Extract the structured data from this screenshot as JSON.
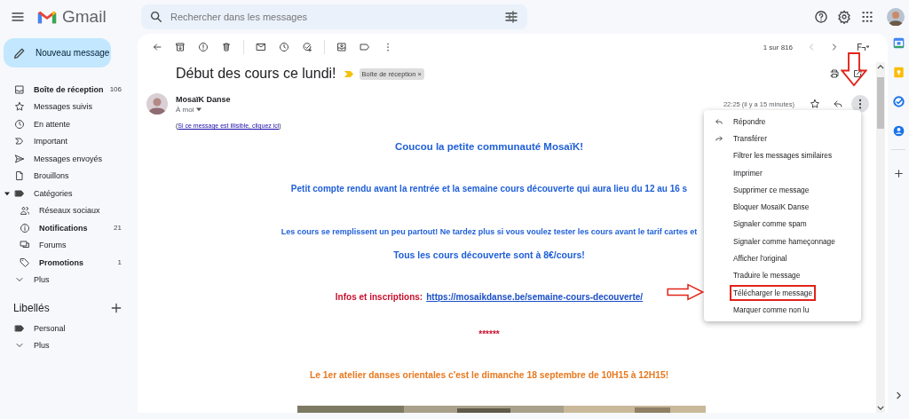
{
  "header": {
    "app_name": "Gmail",
    "search": {
      "placeholder": "Rechercher dans les messages"
    }
  },
  "compose": "Nouveau message",
  "sidebar": {
    "items": [
      {
        "label": "Boîte de réception",
        "count": "106",
        "unread": true
      },
      {
        "label": "Messages suivis",
        "unread": false
      },
      {
        "label": "En attente",
        "unread": false
      },
      {
        "label": "Important",
        "unread": false
      },
      {
        "label": "Messages envoyés",
        "unread": false
      },
      {
        "label": "Brouillons",
        "unread": false
      },
      {
        "label": "Catégories",
        "unread": false,
        "expanded": true,
        "children": [
          {
            "label": "Réseaux sociaux",
            "unread": false
          },
          {
            "label": "Notifications",
            "count": "21",
            "unread": true
          },
          {
            "label": "Forums",
            "unread": false
          },
          {
            "label": "Promotions",
            "count": "1",
            "unread": true
          }
        ]
      },
      {
        "label": "Plus",
        "unread": false
      }
    ]
  },
  "labels": {
    "title": "Libellés",
    "items": [
      {
        "label": "Personal"
      },
      {
        "label": "Plus"
      }
    ]
  },
  "toolbar": {
    "pager": "1 sur 816"
  },
  "message": {
    "subject": "Début des cours ce lundi!",
    "important": true,
    "chip": {
      "label": "Boîte de réception",
      "close": "×"
    },
    "sender": "MosaïK Danse",
    "recipient": "À moi",
    "time": "22:25 (il y a 15 minutes)",
    "notice": {
      "open": "(",
      "link": "Si ce message est illisible, cliquez ici",
      "close": ")"
    },
    "body": [
      {
        "kind": "text",
        "text": "Coucou la petite communauté MosaïK!",
        "color": "#1f5fd8"
      },
      {
        "kind": "text",
        "text": "Petit compte rendu avant la rentrée et la semaine cours découverte qui aura lieu du 12 au 16 s",
        "color": "#1f5fd8"
      },
      {
        "kind": "text",
        "text": "Les cours se remplissent un peu partout! Ne tardez plus si vous voulez tester les cours avant le tarif cartes et",
        "color": "#1f5fd8"
      },
      {
        "kind": "text",
        "text": "Tous les cours découverte sont à 8€/cours!",
        "color": "#1f5fd8"
      },
      {
        "kind": "link",
        "text": "Infos et inscriptions:",
        "link": "https://mosaikdanse.be/semaine-cours-decouverte/",
        "color": "#c8102e"
      },
      {
        "kind": "text",
        "text": "******",
        "color": "#c8102e"
      },
      {
        "kind": "text",
        "text": "Le 1er atelier danses orientales c'est le dimanche 18 septembre de 10H15 à 12H15!",
        "color": "#e8791f"
      }
    ]
  },
  "menu": {
    "items": [
      {
        "kind": "reply",
        "label": "Répondre",
        "highlighted": false
      },
      {
        "kind": "forward",
        "label": "Transférer",
        "highlighted": false
      },
      {
        "kind": "action",
        "label": "Filtrer les messages similaires",
        "highlighted": false
      },
      {
        "kind": "action",
        "label": "Imprimer",
        "highlighted": false
      },
      {
        "kind": "action",
        "label": "Supprimer ce message",
        "highlighted": false
      },
      {
        "kind": "action",
        "label": "Bloquer MosaïK Danse",
        "highlighted": false
      },
      {
        "kind": "action",
        "label": "Signaler comme spam",
        "highlighted": false
      },
      {
        "kind": "action",
        "label": "Signaler comme hameçonnage",
        "highlighted": false
      },
      {
        "kind": "action",
        "label": "Afficher l'original",
        "highlighted": false
      },
      {
        "kind": "action",
        "label": "Traduire le message",
        "highlighted": false
      },
      {
        "kind": "action",
        "label": "Télécharger le message",
        "highlighted": true
      },
      {
        "kind": "action",
        "label": "Marquer comme non lu",
        "highlighted": false
      }
    ]
  }
}
